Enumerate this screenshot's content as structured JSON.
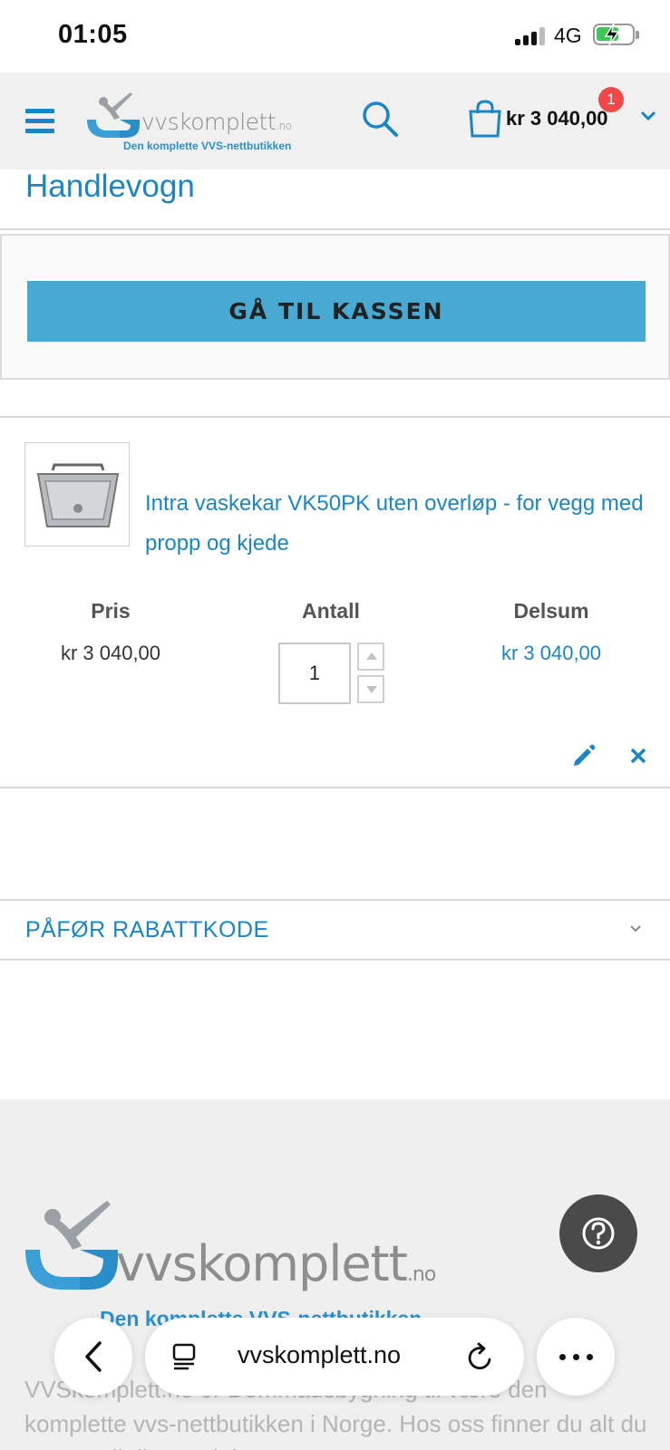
{
  "status_bar": {
    "time": "01:05",
    "network": "4G"
  },
  "header": {
    "logo_text": "vvskomplett",
    "logo_suffix": ".no",
    "logo_tagline": "Den komplette VVS-nettbutikken",
    "cart_count": "1",
    "cart_total": "kr 3 040,00"
  },
  "page": {
    "title": "Handlevogn"
  },
  "checkout": {
    "button_label": "GÅ TIL KASSEN"
  },
  "cart_item": {
    "name": "Intra vaskekar VK50PK uten overløp - for vegg med propp og kjede",
    "price_header": "Pris",
    "qty_header": "Antall",
    "subtotal_header": "Delsum",
    "price": "kr 3 040,00",
    "quantity": "1",
    "subtotal": "kr 3 040,00"
  },
  "discount": {
    "label": "PÅFØR RABATTKODE"
  },
  "footer": {
    "logo_text": "vvskomplett",
    "logo_suffix": ".no",
    "tagline": "Den komplette VVS-nettbutikken",
    "text": "VVSkomplett.no er Dommadsbygning til være den komplette vvs-nettbutikken i Norge. Hos oss finner du alt du trenger til ditt prosjekt"
  },
  "browser": {
    "url": "vvskomplett.no"
  },
  "colors": {
    "accent": "#1a86c7",
    "button": "#48a9d2",
    "badge": "#f04848"
  }
}
